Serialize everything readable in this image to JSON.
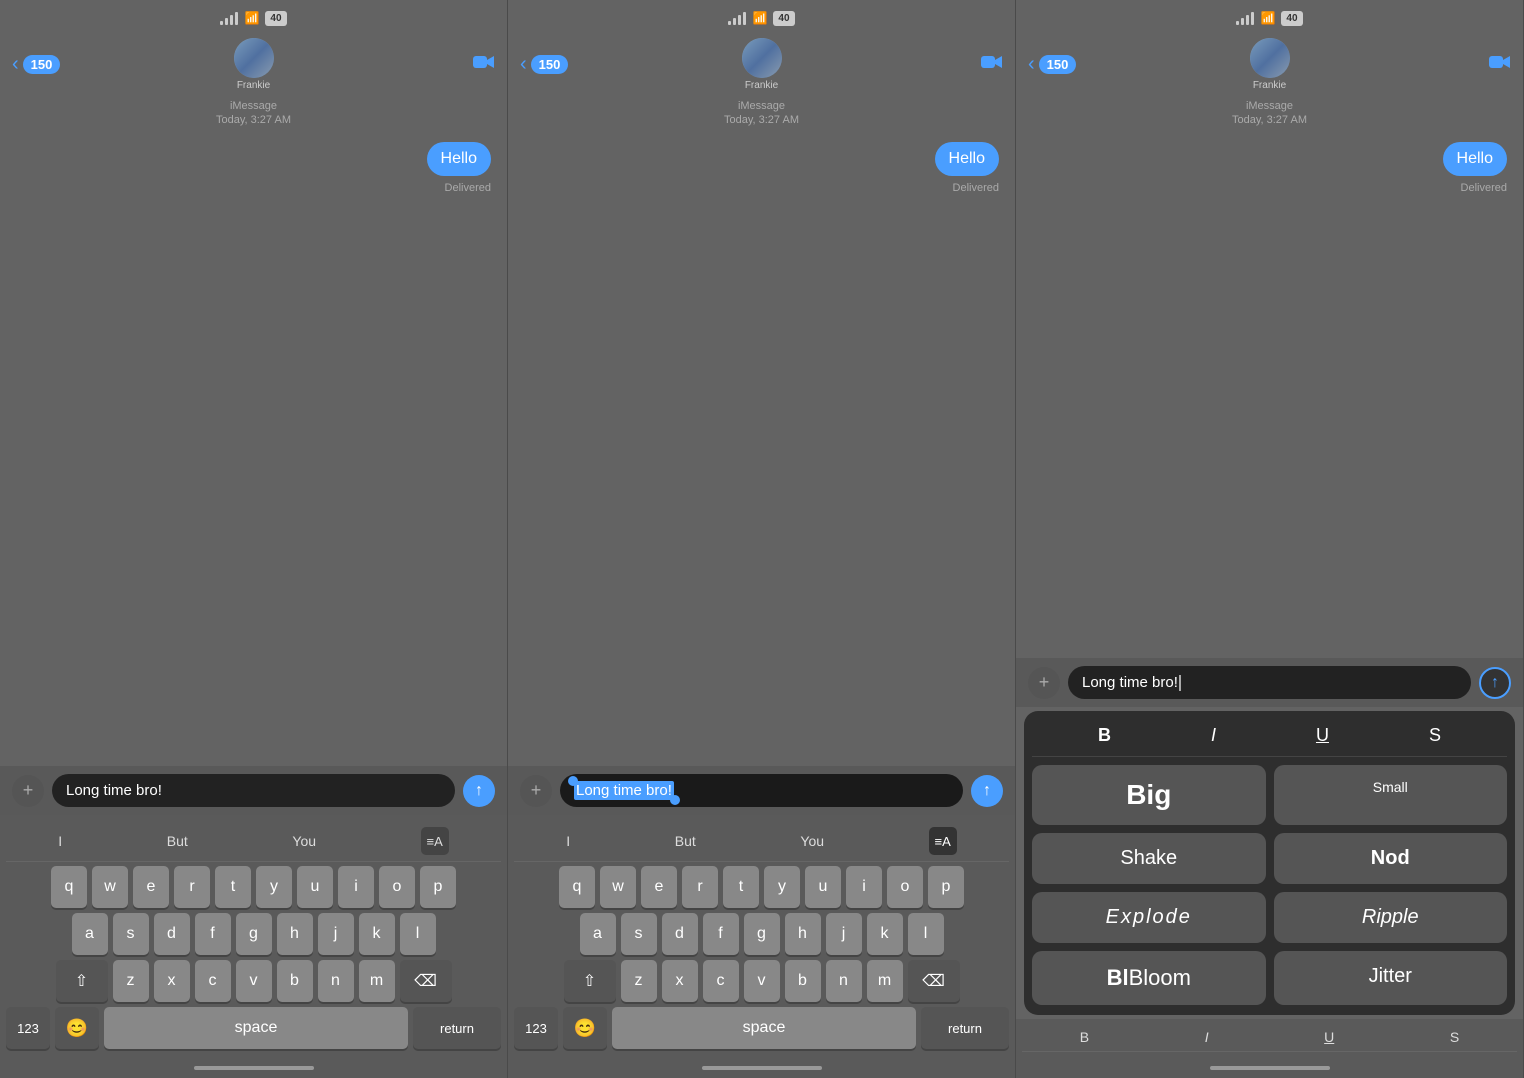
{
  "panels": [
    {
      "id": "panel1",
      "statusBar": {
        "battery": "40"
      },
      "header": {
        "backCount": "150",
        "contactName": "Frankie",
        "videoIcon": "📹"
      },
      "messages": {
        "label": "iMessage",
        "time": "Today, 3:27 AM",
        "bubble": "Hello",
        "status": "Delivered"
      },
      "inputBar": {
        "plusLabel": "+",
        "text": "Long time bro!",
        "sendIcon": "↑"
      }
    },
    {
      "id": "panel2",
      "statusBar": {
        "battery": "40"
      },
      "header": {
        "backCount": "150",
        "contactName": "Frankie",
        "videoIcon": "📹"
      },
      "messages": {
        "label": "iMessage",
        "time": "Today, 3:27 AM",
        "bubble": "Hello",
        "status": "Delivered"
      },
      "inputBar": {
        "plusLabel": "+",
        "text": "Long time bro!",
        "sendIcon": "↑",
        "textSelected": true
      }
    },
    {
      "id": "panel3",
      "statusBar": {
        "battery": "40"
      },
      "header": {
        "backCount": "150",
        "contactName": "Frankie",
        "videoIcon": "📹"
      },
      "messages": {
        "label": "iMessage",
        "time": "Today, 3:27 AM",
        "bubble": "Hello",
        "status": "Delivered"
      },
      "inputBar": {
        "plusLabel": "+",
        "text": "Long time bro!",
        "sendIcon": "↑"
      },
      "effects": {
        "formatBar": [
          "B",
          "I",
          "U",
          "S"
        ],
        "items": [
          {
            "label": "Big",
            "style": "big"
          },
          {
            "label": "Small",
            "style": "small"
          },
          {
            "label": "Shake",
            "style": "shake"
          },
          {
            "label": "Nod",
            "style": "nod"
          },
          {
            "label": "Explode",
            "style": "explode"
          },
          {
            "label": "Ripple",
            "style": "ripple"
          },
          {
            "label": "Bloom",
            "style": "bloom"
          },
          {
            "label": "Jitter",
            "style": "jitter"
          }
        ]
      }
    }
  ],
  "keyboard": {
    "suggestions": [
      "I",
      "But",
      "You"
    ],
    "row1": [
      "q",
      "w",
      "e",
      "r",
      "t",
      "y",
      "u",
      "i",
      "o",
      "p"
    ],
    "row2": [
      "a",
      "s",
      "d",
      "f",
      "g",
      "h",
      "j",
      "k",
      "l"
    ],
    "row3": [
      "z",
      "x",
      "c",
      "v",
      "b",
      "n",
      "m"
    ],
    "bottomLeft": "123",
    "emoji": "😊",
    "space": "space",
    "return": "return"
  }
}
